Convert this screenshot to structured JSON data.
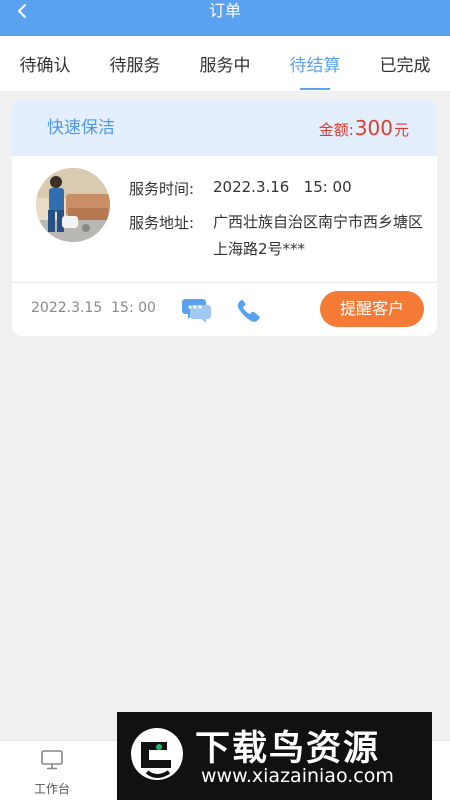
{
  "header": {
    "title": "订单",
    "back_icon": "chevron-left-icon"
  },
  "tabs": [
    {
      "label": "待确认",
      "active": false
    },
    {
      "label": "待服务",
      "active": false
    },
    {
      "label": "服务中",
      "active": false
    },
    {
      "label": "待结算",
      "active": true
    },
    {
      "label": "已完成",
      "active": false
    }
  ],
  "order": {
    "service_name": "快速保洁",
    "amount_label": "金额:",
    "amount_value": "300",
    "amount_unit": "元",
    "service_time_label": "服务时间:",
    "service_time_value": "2022.3.16   15: 00",
    "service_address_label": "服务地址:",
    "service_address_value": "广西壮族自治区南宁市西乡塘区上海路2号***",
    "created_time": "2022.3.15  15: 00",
    "chat_icon": "chat-bubble-icon",
    "phone_icon": "phone-icon",
    "remind_button": "提醒客户"
  },
  "bottom_nav": {
    "workbench_label": "工作台",
    "workbench_icon": "monitor-icon"
  },
  "watermark": {
    "title": "下载鸟资源",
    "url": "www.xiazainiao.com"
  },
  "colors": {
    "accent": "#5aa2ef",
    "amount": "#e23a2a",
    "button": "#f47a36"
  }
}
